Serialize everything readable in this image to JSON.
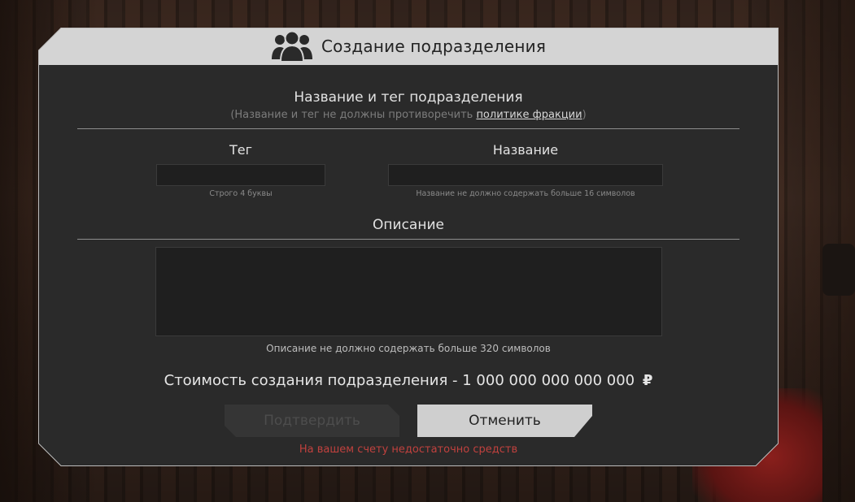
{
  "modal": {
    "title": "Создание подразделения",
    "title_icon": "users-group-icon"
  },
  "name_section": {
    "title": "Название и тег подразделения",
    "note_prefix": "(Название и тег не должны противоречить ",
    "note_link": "политике фракции",
    "note_suffix": ")"
  },
  "tag_field": {
    "label": "Тег",
    "value": "",
    "hint": "Строго 4 буквы"
  },
  "name_field": {
    "label": "Название",
    "value": "",
    "hint": "Название не должно содержать больше 16 символов"
  },
  "description": {
    "title": "Описание",
    "value": "",
    "hint": "Описание не должно содержать больше 320 символов"
  },
  "cost": {
    "label": "Стоимость создания подразделения - 1 000 000 000 000 000",
    "currency": "₽"
  },
  "buttons": {
    "confirm": "Подтвердить",
    "cancel": "Отменить"
  },
  "error": "На вашем счету недостаточно средств",
  "colors": {
    "panel": "#2a2a2a",
    "header": "#d4d4d4",
    "error": "#c0413e",
    "cancel_button": "#cfcfcf",
    "confirm_button_disabled": "#353535"
  }
}
